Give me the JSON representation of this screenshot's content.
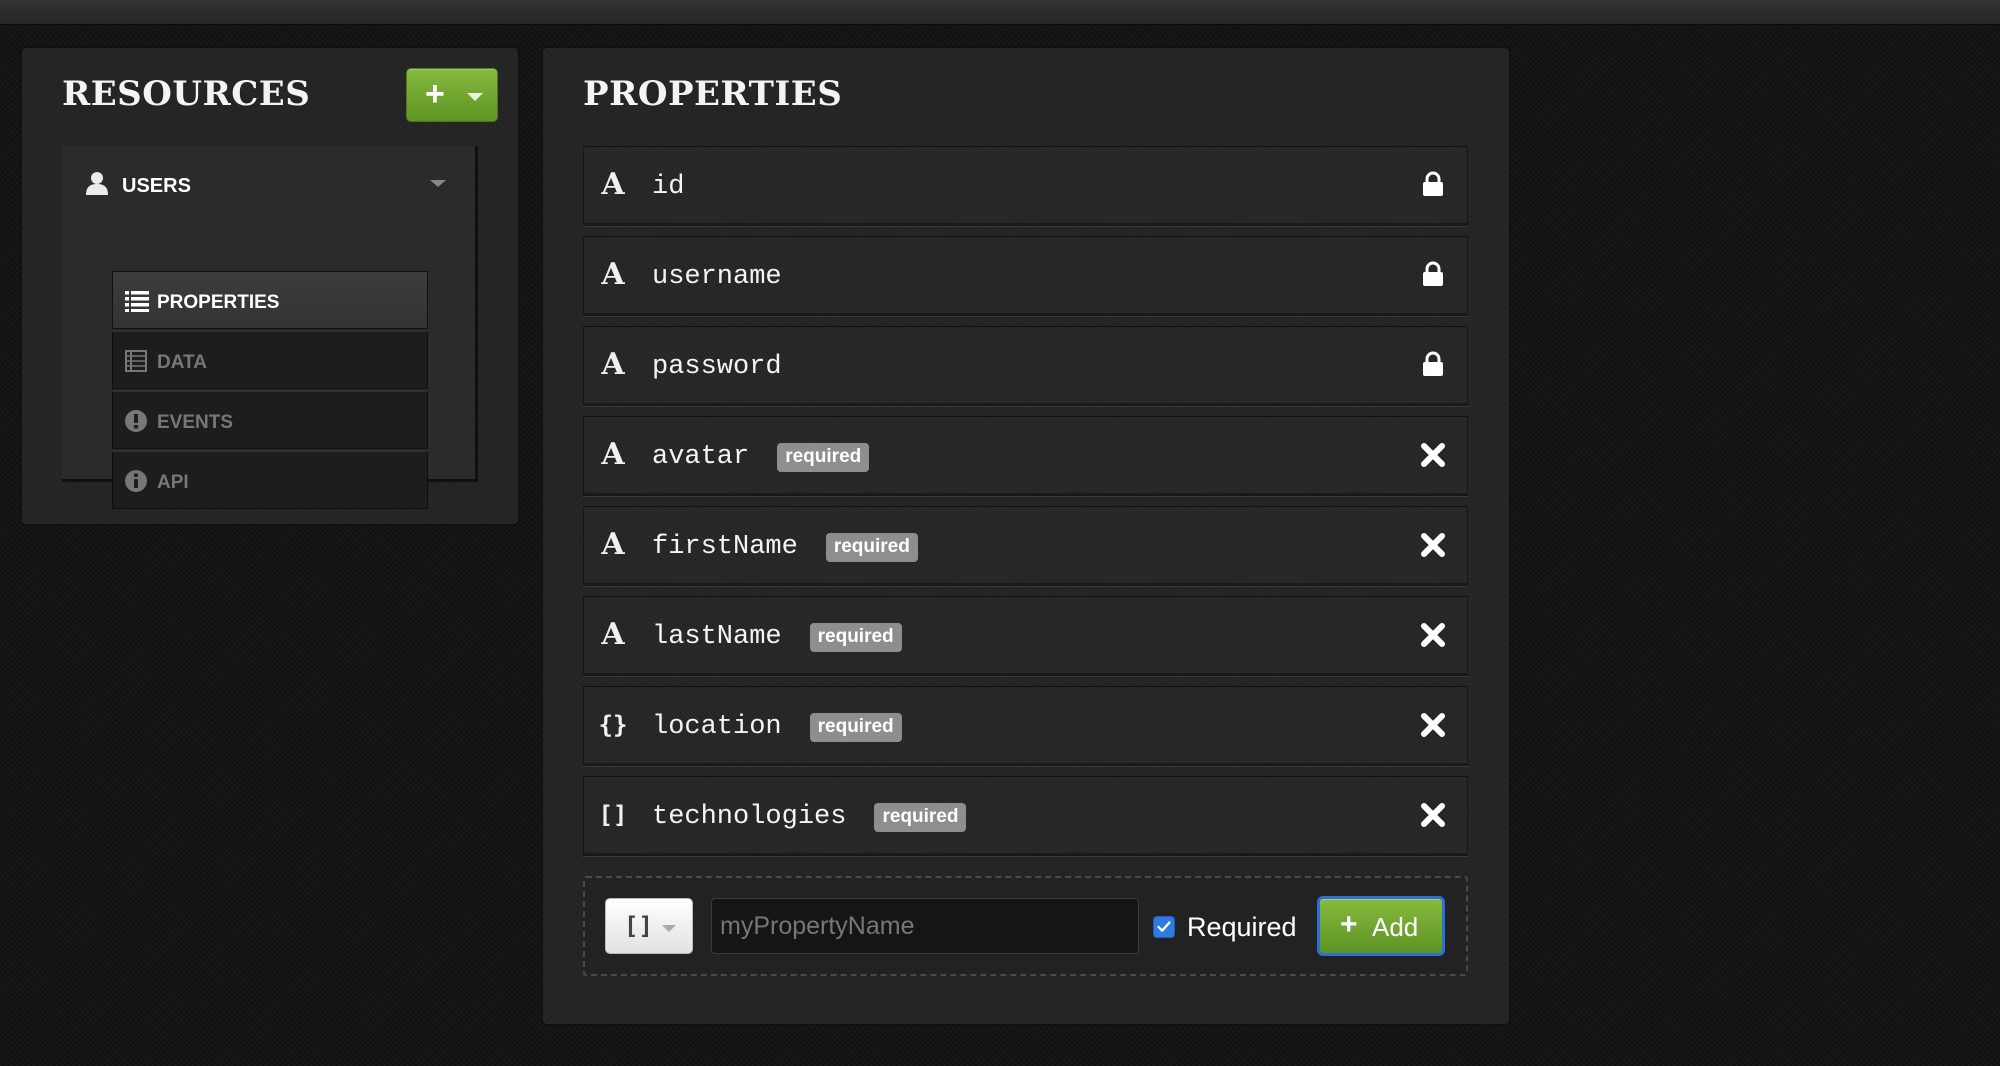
{
  "resources_panel": {
    "title": "RESOURCES",
    "add_button": {
      "icon": "plus-icon",
      "dropdown_icon": "caret-down-icon"
    },
    "resource": {
      "name": "USERS",
      "icon": "user-icon",
      "nav": [
        {
          "label": "PROPERTIES",
          "icon": "list-icon",
          "active": true
        },
        {
          "label": "DATA",
          "icon": "table-icon",
          "active": false
        },
        {
          "label": "EVENTS",
          "icon": "exclamation-icon",
          "active": false
        },
        {
          "label": "API",
          "icon": "info-icon",
          "active": false
        }
      ]
    }
  },
  "properties_panel": {
    "title": "PROPERTIES",
    "properties": [
      {
        "name": "id",
        "type": "string",
        "type_glyph": "A",
        "required_label": "",
        "action": "lock"
      },
      {
        "name": "username",
        "type": "string",
        "type_glyph": "A",
        "required_label": "",
        "action": "lock"
      },
      {
        "name": "password",
        "type": "string",
        "type_glyph": "A",
        "required_label": "",
        "action": "lock"
      },
      {
        "name": "avatar",
        "type": "string",
        "type_glyph": "A",
        "required_label": "required",
        "action": "delete"
      },
      {
        "name": "firstName",
        "type": "string",
        "type_glyph": "A",
        "required_label": "required",
        "action": "delete"
      },
      {
        "name": "lastName",
        "type": "string",
        "type_glyph": "A",
        "required_label": "required",
        "action": "delete"
      },
      {
        "name": "location",
        "type": "object",
        "type_glyph": "{}",
        "required_label": "required",
        "action": "delete"
      },
      {
        "name": "technologies",
        "type": "array",
        "type_glyph": "[]",
        "required_label": "required",
        "action": "delete"
      }
    ],
    "add_form": {
      "type_select_value": "[]",
      "name_placeholder": "myPropertyName",
      "name_value": "",
      "required_checked": true,
      "required_label": "Required",
      "add_button_label": "Add"
    }
  },
  "colors": {
    "background": "#141414",
    "panel": "#242424",
    "accent_green": "#6fa52f",
    "badge_gray": "#8e8e8e",
    "focus_blue": "#2d6fd6"
  }
}
